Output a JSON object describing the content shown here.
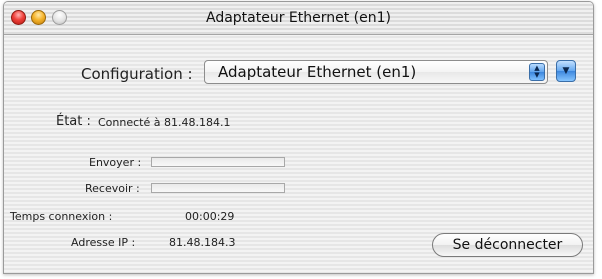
{
  "window": {
    "title": "Adaptateur Ethernet (en1)"
  },
  "config": {
    "label": "Configuration :",
    "value": "Adaptateur Ethernet (en1)"
  },
  "status": {
    "label": "État :",
    "value": "Connecté à 81.48.184.1"
  },
  "traffic": {
    "send_label": "Envoyer :",
    "send_level": 0,
    "receive_label": "Recevoir :",
    "receive_level": 0
  },
  "connection": {
    "time_label": "Temps connexion :",
    "time_value": "00:00:29",
    "ip_label": "Adresse IP :",
    "ip_value": "81.48.184.3"
  },
  "actions": {
    "disconnect_label": "Se déconnecter"
  },
  "icons": {
    "close": "close-icon",
    "minimize": "minimize-icon",
    "zoom": "zoom-icon",
    "popup_arrows": "updown-arrows-icon",
    "menu": "chevron-down-icon"
  },
  "colors": {
    "close": "#f0413b",
    "minimize": "#f6b52d",
    "accent": "#3d87de"
  }
}
